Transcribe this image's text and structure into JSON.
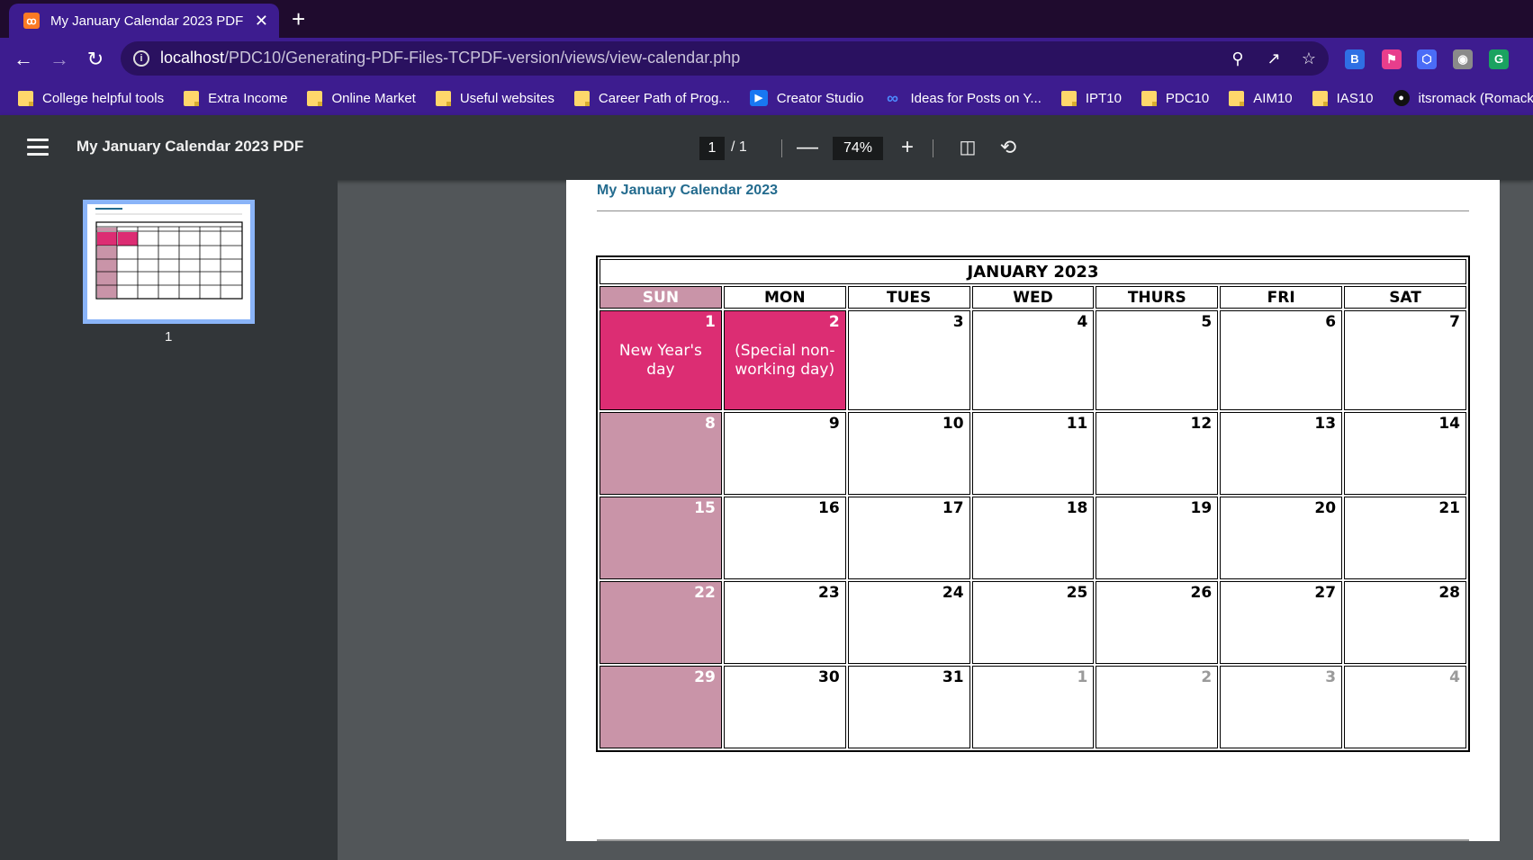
{
  "browser": {
    "tab": {
      "title": "My January Calendar 2023 PDF",
      "favicon": "xampp-icon",
      "close_label": "✕"
    },
    "new_tab_label": "+",
    "url": {
      "host": "localhost",
      "path": "/PDC10/Generating-PDF-Files-TCPDF-version/views/view-calendar.php"
    },
    "bookmarks": [
      {
        "label": "College helpful tools",
        "icon": "folder-icon"
      },
      {
        "label": "Extra Income",
        "icon": "folder-icon"
      },
      {
        "label": "Online Market",
        "icon": "folder-icon"
      },
      {
        "label": "Useful websites",
        "icon": "folder-icon"
      },
      {
        "label": "Career Path of Prog...",
        "icon": "folder-icon"
      },
      {
        "label": "Creator Studio",
        "icon": "creator-studio-icon"
      },
      {
        "label": "Ideas for Posts on Y...",
        "icon": "meta-icon"
      },
      {
        "label": "IPT10",
        "icon": "folder-icon"
      },
      {
        "label": "PDC10",
        "icon": "folder-icon"
      },
      {
        "label": "AIM10",
        "icon": "folder-icon"
      },
      {
        "label": "IAS10",
        "icon": "folder-icon"
      },
      {
        "label": "itsromack (Romack...",
        "icon": "github-icon"
      }
    ]
  },
  "viewer": {
    "title": "My January Calendar 2023 PDF",
    "page_current": "1",
    "page_total": "/ 1",
    "zoom": "74%",
    "thumbnail_label": "1"
  },
  "document": {
    "heading": "My January Calendar 2023",
    "calendar": {
      "month": "JANUARY 2023",
      "days": [
        "SUN",
        "MON",
        "TUES",
        "WED",
        "THURS",
        "FRI",
        "SAT"
      ],
      "weeks": [
        [
          {
            "n": "1",
            "type": "holiday",
            "note": "New Year's day"
          },
          {
            "n": "2",
            "type": "holiday",
            "note": "(Special non-working day)"
          },
          {
            "n": "3"
          },
          {
            "n": "4"
          },
          {
            "n": "5"
          },
          {
            "n": "6"
          },
          {
            "n": "7"
          }
        ],
        [
          {
            "n": "8",
            "type": "sun"
          },
          {
            "n": "9"
          },
          {
            "n": "10"
          },
          {
            "n": "11"
          },
          {
            "n": "12"
          },
          {
            "n": "13"
          },
          {
            "n": "14"
          }
        ],
        [
          {
            "n": "15",
            "type": "sun"
          },
          {
            "n": "16"
          },
          {
            "n": "17"
          },
          {
            "n": "18"
          },
          {
            "n": "19"
          },
          {
            "n": "20"
          },
          {
            "n": "21"
          }
        ],
        [
          {
            "n": "22",
            "type": "sun"
          },
          {
            "n": "23"
          },
          {
            "n": "24"
          },
          {
            "n": "25"
          },
          {
            "n": "26"
          },
          {
            "n": "27"
          },
          {
            "n": "28"
          }
        ],
        [
          {
            "n": "29",
            "type": "sun"
          },
          {
            "n": "30"
          },
          {
            "n": "31"
          },
          {
            "n": "1",
            "type": "next"
          },
          {
            "n": "2",
            "type": "next"
          },
          {
            "n": "3",
            "type": "next"
          },
          {
            "n": "4",
            "type": "next"
          }
        ]
      ]
    }
  },
  "colors": {
    "tab_bar": "#1f0b2e",
    "browser_chrome": "#3d1c8f",
    "holiday": "#dc2d73",
    "sunday": "#c994a8",
    "heading": "#236b8e"
  }
}
